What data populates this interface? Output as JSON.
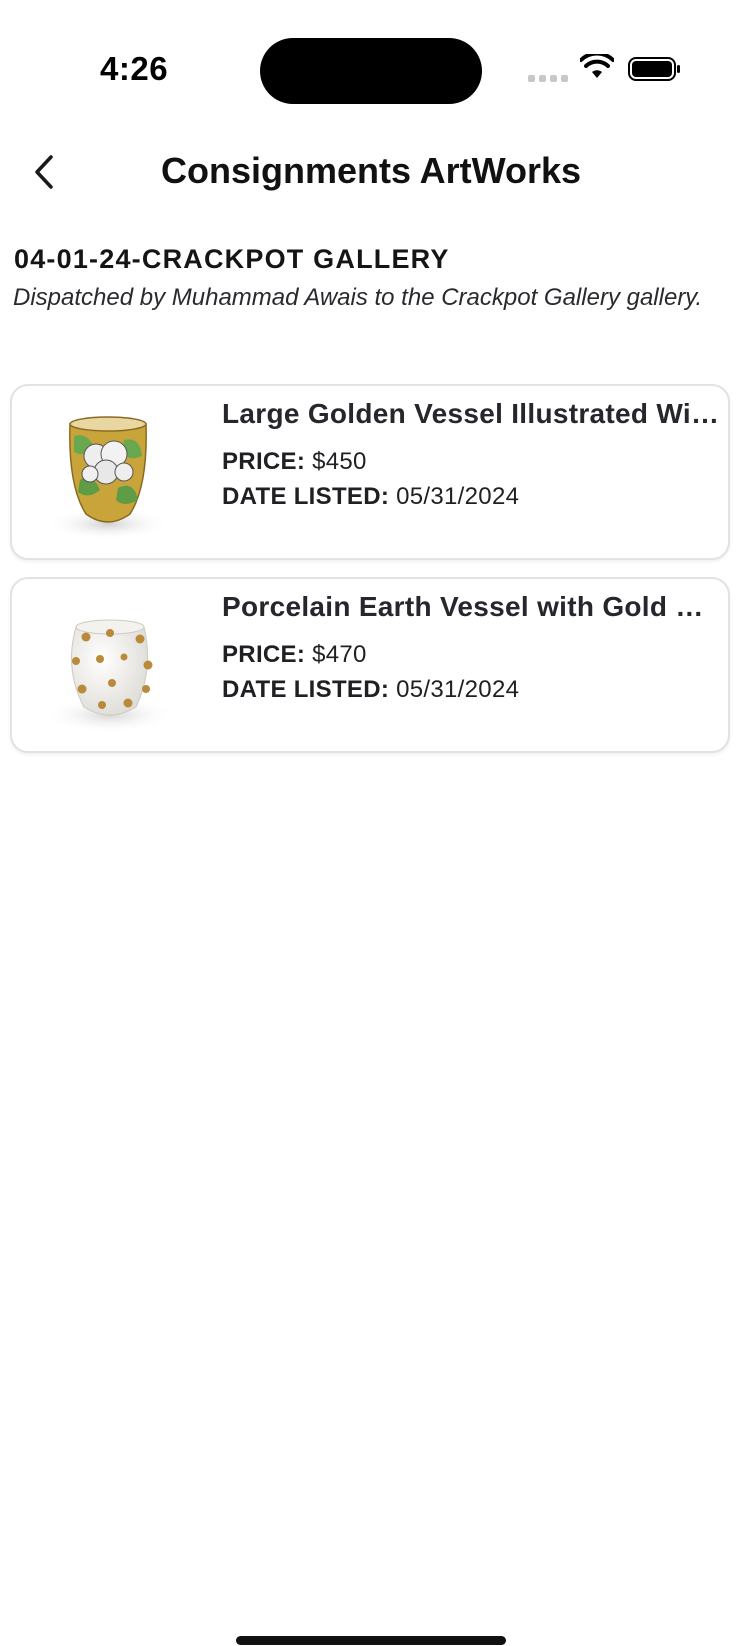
{
  "status_bar": {
    "time": "4:26"
  },
  "nav": {
    "title": "Consignments ArtWorks",
    "back_icon": "chevron-left-icon"
  },
  "consignment": {
    "title": "04-01-24-CRACKPOT GALLERY",
    "description": "Dispatched by Muhammad Awais to the Crackpot Gallery gallery."
  },
  "labels": {
    "price": "PRICE:",
    "date_listed": "DATE LISTED:"
  },
  "artworks": [
    {
      "name": "Large Golden Vessel Illustrated With Hydrangeas",
      "price": "$450",
      "date_listed": "05/31/2024",
      "thumbnail": "golden-vessel-thumbnail"
    },
    {
      "name": "Porcelain Earth Vessel with Gold Nuggets",
      "price": "$470",
      "date_listed": "05/31/2024",
      "thumbnail": "porcelain-vessel-thumbnail"
    }
  ],
  "colors": {
    "card_border": "#e1e1e6",
    "text_primary": "#1c1c22",
    "background": "#ffffff"
  }
}
